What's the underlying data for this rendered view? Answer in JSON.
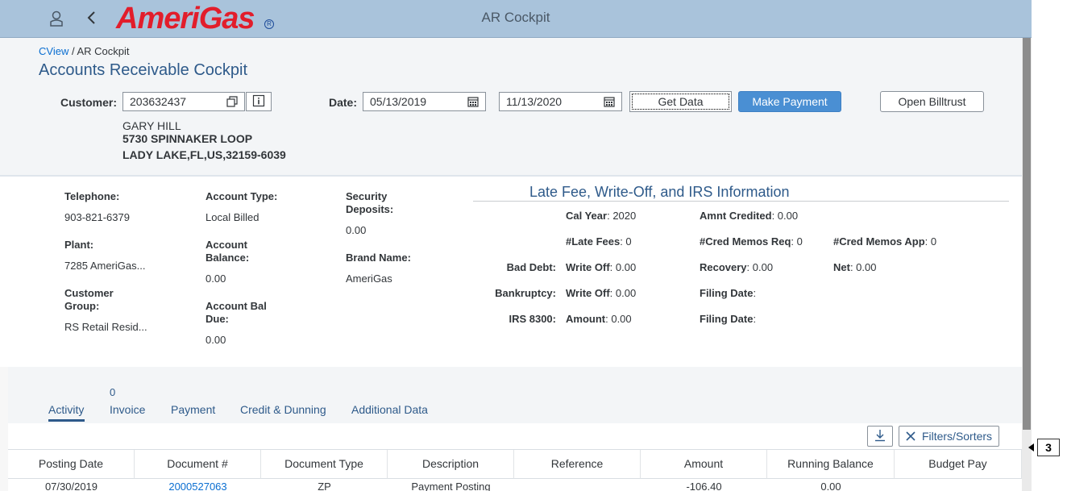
{
  "shell": {
    "logo_text": "AmeriGas",
    "logo_reg": "R",
    "title": "AR Cockpit"
  },
  "header": {
    "breadcrumb_link": "CView",
    "breadcrumb_sep": " / ",
    "breadcrumb_current": "AR Cockpit",
    "page_title": "Accounts Receivable Cockpit",
    "customer_label": "Customer:",
    "customer_value": "203632437",
    "date_label": "Date:",
    "date_from": "05/13/2019",
    "date_to": "11/13/2020",
    "get_data_label": "Get Data",
    "make_payment_label": "Make Payment",
    "open_billtrust_label": "Open Billtrust",
    "name": "GARY HILL",
    "address1": "5730 SPINNAKER LOOP",
    "address2": "LADY LAKE,FL,US,32159-6039"
  },
  "details": {
    "telephone_label": "Telephone:",
    "telephone_value": "903-821-6379",
    "plant_label": "Plant:",
    "plant_value": "7285 AmeriGas...",
    "customer_group_label_1": "Customer",
    "customer_group_label_2": "Group:",
    "customer_group_value": "RS Retail Resid...",
    "account_type_label": "Account Type:",
    "account_type_value": "Local Billed",
    "account_balance_label_1": "Account",
    "account_balance_label_2": "Balance:",
    "account_balance_value": "0.00",
    "account_bal_due_label_1": "Account Bal",
    "account_bal_due_label_2": "Due:",
    "account_bal_due_value": "0.00",
    "security_deposits_label_1": "Security",
    "security_deposits_label_2": "Deposits:",
    "security_deposits_value": "0.00",
    "brand_name_label": "Brand Name:",
    "brand_name_value": "AmeriGas"
  },
  "irs": {
    "title": "Late Fee, Write-Off, and IRS Information",
    "cal_year_label": "Cal Year",
    "cal_year_value": ": 2020",
    "amnt_credited_label": "Amnt Credited",
    "amnt_credited_value": ": 0.00",
    "late_fees_label": "#Late Fees",
    "late_fees_value": ": 0",
    "cred_memos_req_label": "#Cred Memos Req",
    "cred_memos_req_value": ": 0",
    "cred_memos_app_label": "#Cred Memos App",
    "cred_memos_app_value": ": 0",
    "bad_debt_label": "Bad Debt:",
    "bad_debt_writeoff_label": "Write Off",
    "bad_debt_writeoff_value": ": 0.00",
    "recovery_label": "Recovery",
    "recovery_value": ": 0.00",
    "net_label": "Net",
    "net_value": ": 0.00",
    "bankruptcy_label": "Bankruptcy:",
    "bankruptcy_writeoff_label": "Write Off",
    "bankruptcy_writeoff_value": ": 0.00",
    "bankruptcy_filing_label": "Filing Date",
    "bankruptcy_filing_value": ":",
    "irs_label": "IRS 8300:",
    "irs_amount_label": "Amount",
    "irs_amount_value": ": 0.00",
    "irs_filing_label": "Filing Date",
    "irs_filing_value": ":"
  },
  "tabs": {
    "invoice_count": "0",
    "activity": "Activity",
    "invoice": "Invoice",
    "payment": "Payment",
    "credit_dunning": "Credit & Dunning",
    "additional_data": "Additional Data"
  },
  "toolbar": {
    "filters_label": "Filters/Sorters"
  },
  "table": {
    "columns": [
      "Posting Date",
      "Document #",
      "Document Type",
      "Description",
      "Reference",
      "Amount",
      "Running Balance",
      "Budget Pay"
    ],
    "row1": [
      "07/30/2019",
      "2000527063",
      "ZP",
      "Payment Posting",
      "",
      "-106.40",
      "0.00",
      ""
    ]
  },
  "badge": {
    "value": "3"
  },
  "colors": {
    "shell_bg": "#a9c3db",
    "accent": "#2e5a8a",
    "primary_button": "#4a8fd3",
    "logo_red": "#e21d2b"
  }
}
